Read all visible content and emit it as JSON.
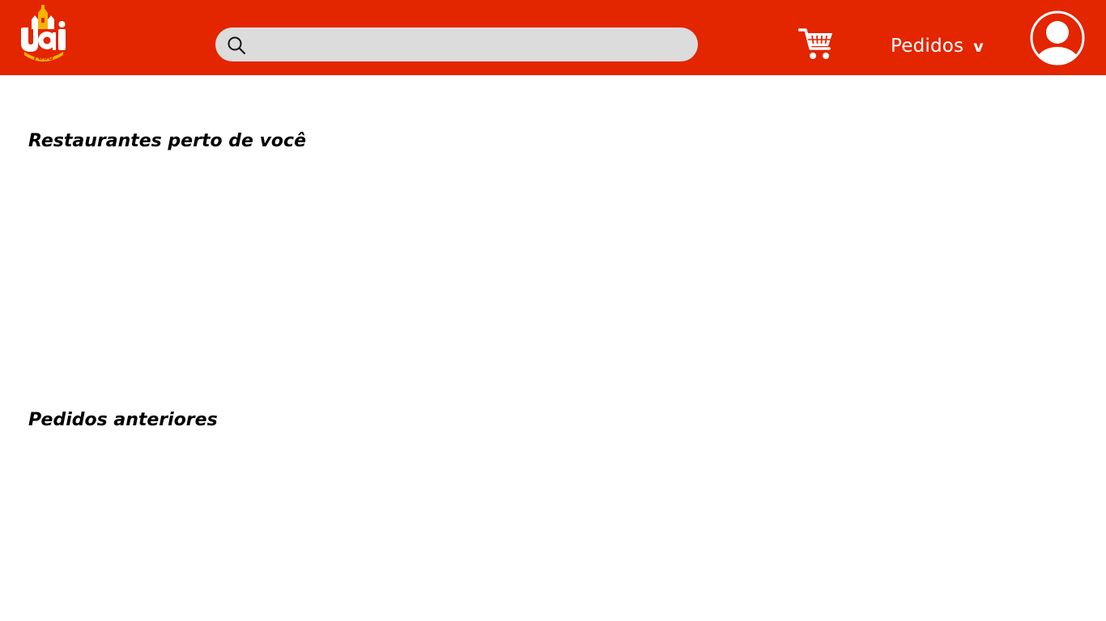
{
  "app": {
    "logo_text": "uai",
    "logo_subtext": "Food"
  },
  "colors": {
    "brand": "#e32500",
    "logo_yellow": "#f7b500",
    "search_bg": "#dcdcdc"
  },
  "header": {
    "search": {
      "placeholder": "",
      "value": "",
      "icon": "search-icon"
    },
    "cart_icon": "cart-icon",
    "orders_menu": {
      "label": "Pedidos",
      "caret": "v"
    },
    "avatar_icon": "user-avatar-icon"
  },
  "main": {
    "sections": [
      {
        "title": "Restaurantes perto de você",
        "items": []
      },
      {
        "title": "Pedidos anteriores",
        "items": []
      }
    ]
  }
}
